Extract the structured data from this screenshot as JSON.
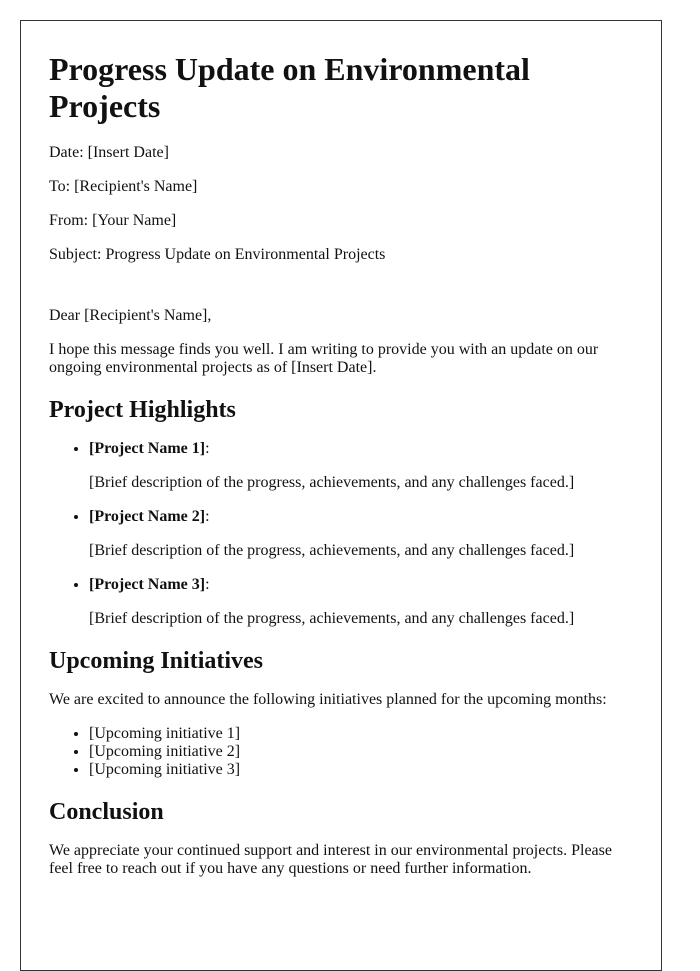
{
  "title": "Progress Update on Environmental Projects",
  "meta": {
    "date": "Date: [Insert Date]",
    "to": "To: [Recipient's Name]",
    "from": "From: [Your Name]",
    "subject": "Subject: Progress Update on Environmental Projects"
  },
  "greeting": "Dear [Recipient's Name],",
  "intro": "I hope this message finds you well. I am writing to provide you with an update on our ongoing environmental projects as of [Insert Date].",
  "highlights": {
    "heading": "Project Highlights",
    "projects": [
      {
        "name": "[Project Name 1]",
        "suffix": ":",
        "description": "[Brief description of the progress, achievements, and any challenges faced.]"
      },
      {
        "name": "[Project Name 2]",
        "suffix": ":",
        "description": "[Brief description of the progress, achievements, and any challenges faced.]"
      },
      {
        "name": "[Project Name 3]",
        "suffix": ":",
        "description": "[Brief description of the progress, achievements, and any challenges faced.]"
      }
    ]
  },
  "initiatives": {
    "heading": "Upcoming Initiatives",
    "intro": "We are excited to announce the following initiatives planned for the upcoming months:",
    "items": [
      "[Upcoming initiative 1]",
      "[Upcoming initiative 2]",
      "[Upcoming initiative 3]"
    ]
  },
  "conclusion": {
    "heading": "Conclusion",
    "text": "We appreciate your continued support and interest in our environmental projects. Please feel free to reach out if you have any questions or need further information."
  }
}
